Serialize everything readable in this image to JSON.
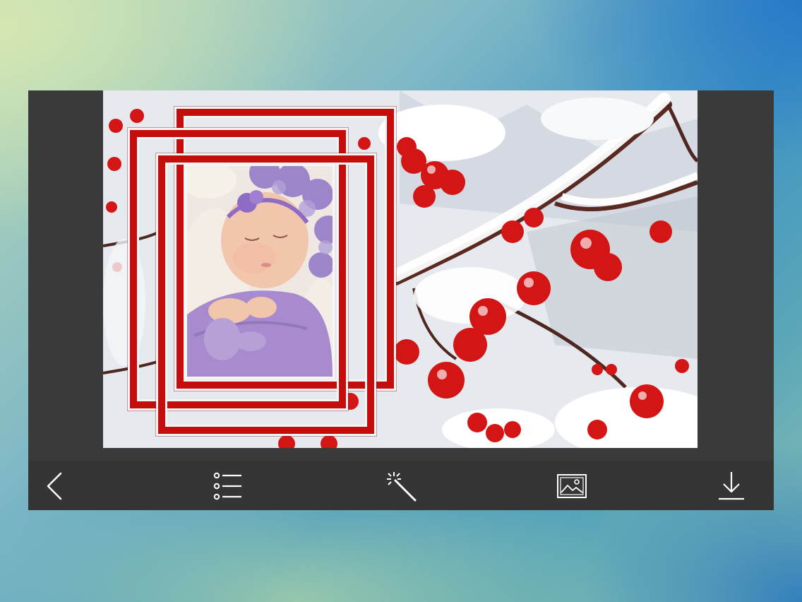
{
  "toolbar": {
    "items": [
      {
        "name": "back-button",
        "icon": "chevron-left-icon"
      },
      {
        "name": "frames-list-button",
        "icon": "list-icon"
      },
      {
        "name": "effects-button",
        "icon": "magic-wand-icon"
      },
      {
        "name": "background-gallery-button",
        "icon": "image-icon"
      },
      {
        "name": "save-button",
        "icon": "download-icon"
      }
    ],
    "icon_color": "#ffffff",
    "background": "#353535"
  },
  "canvas": {
    "background_theme": "snowy-red-berries",
    "frame_color": "#c40d0d",
    "frame_count": 3,
    "photo_subject": "sleeping-baby"
  }
}
